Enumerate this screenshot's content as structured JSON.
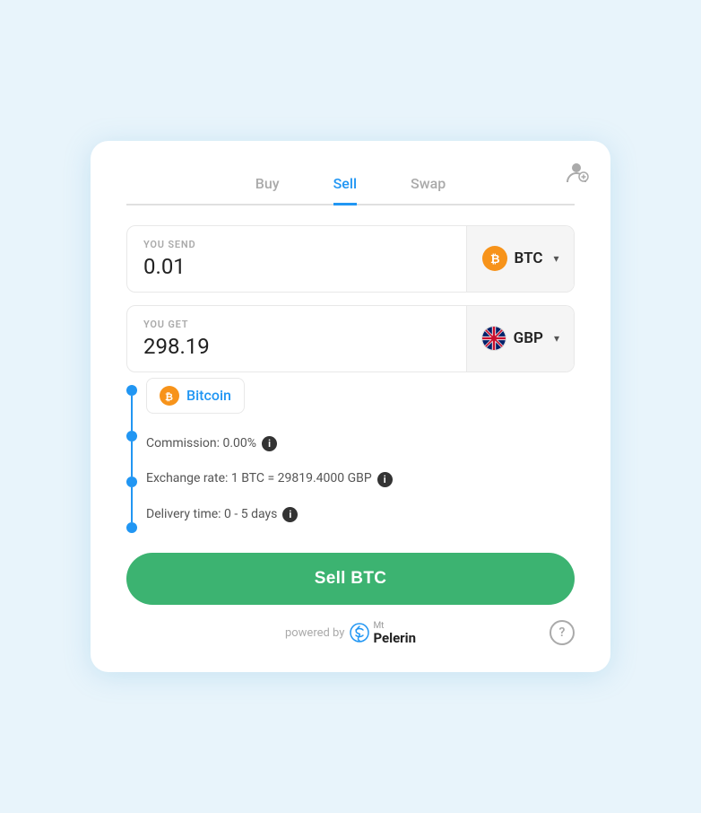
{
  "tabs": [
    {
      "label": "Buy",
      "active": false
    },
    {
      "label": "Sell",
      "active": true
    },
    {
      "label": "Swap",
      "active": false
    }
  ],
  "you_send": {
    "label": "YOU SEND",
    "value": "0.01",
    "currency": "BTC",
    "currency_icon": "btc"
  },
  "you_get": {
    "label": "YOU GET",
    "value": "298.19",
    "currency": "GBP",
    "currency_icon": "gbp"
  },
  "suggestion": {
    "label": "Bitcoin"
  },
  "info_rows": [
    {
      "text": "Commission: 0.00%",
      "has_info": true
    },
    {
      "text": "Exchange rate: 1 BTC = 29819.4000 GBP",
      "has_info": true
    },
    {
      "text": "Delivery time: 0 - 5 days",
      "has_info": true
    }
  ],
  "sell_button": {
    "label": "Sell BTC"
  },
  "footer": {
    "powered_by": "powered by",
    "brand_name": "Mt\nPelerin",
    "brand_small": "Mt",
    "brand_big": "Pelerin"
  },
  "icons": {
    "info": "i",
    "chevron": "▾",
    "question": "?",
    "btc_symbol": "₿"
  }
}
